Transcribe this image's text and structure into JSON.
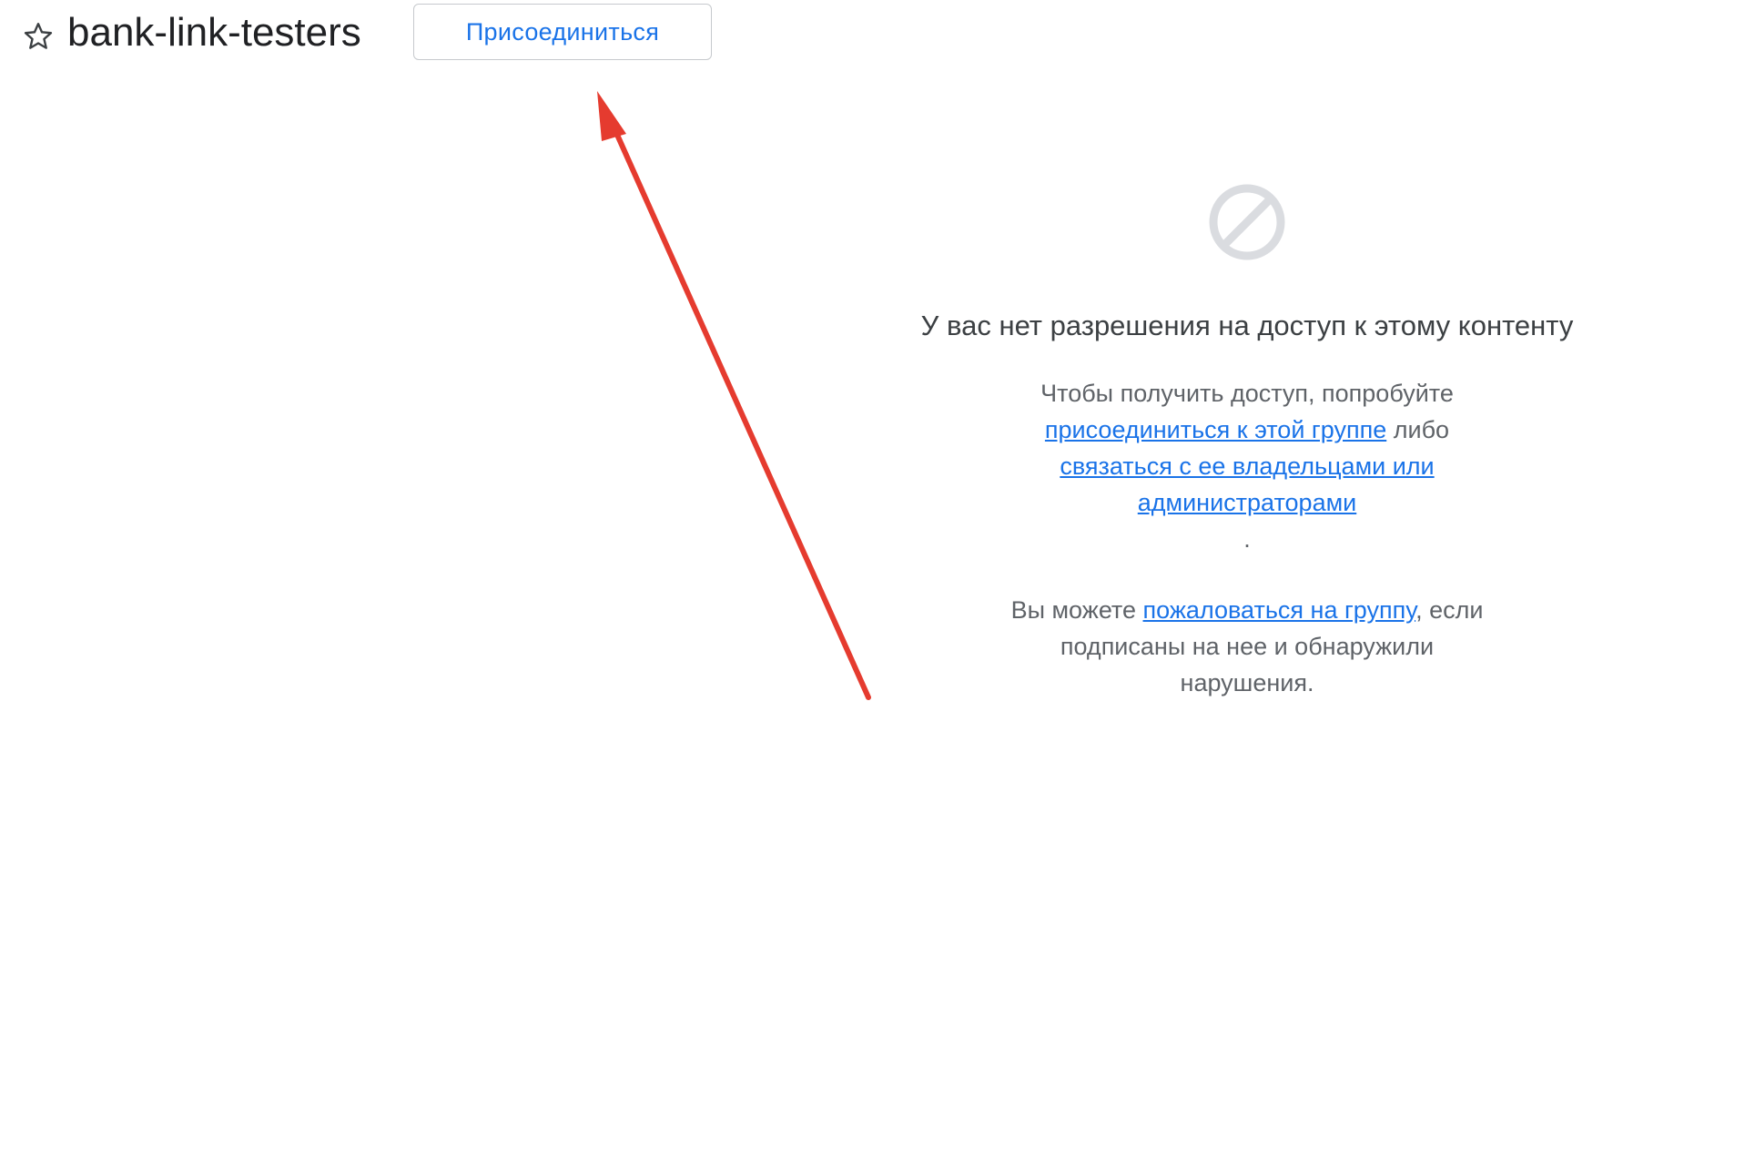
{
  "header": {
    "star_icon": "star-outline-icon",
    "title": "bank-link-testers",
    "join_label": "Присоединиться"
  },
  "annotation": {
    "arrow_color": "#e53b2f"
  },
  "message": {
    "icon": "no-access-icon",
    "heading": "У вас нет разрешения на доступ к этому контенту",
    "access_prefix": "Чтобы получить доступ, попробуйте",
    "join_link": "присоединиться к этой группе",
    "or_text": "либо",
    "contact_link": "связаться с ее владельцами или администраторами",
    "period": ".",
    "report_prefix": "Вы можете",
    "report_link": "пожаловаться на группу",
    "report_suffix": ", если подписаны на нее и обнаружили нарушения."
  },
  "colors": {
    "link": "#1a73e8",
    "text_muted": "#5f6368",
    "icon_gray": "#dadce0"
  }
}
